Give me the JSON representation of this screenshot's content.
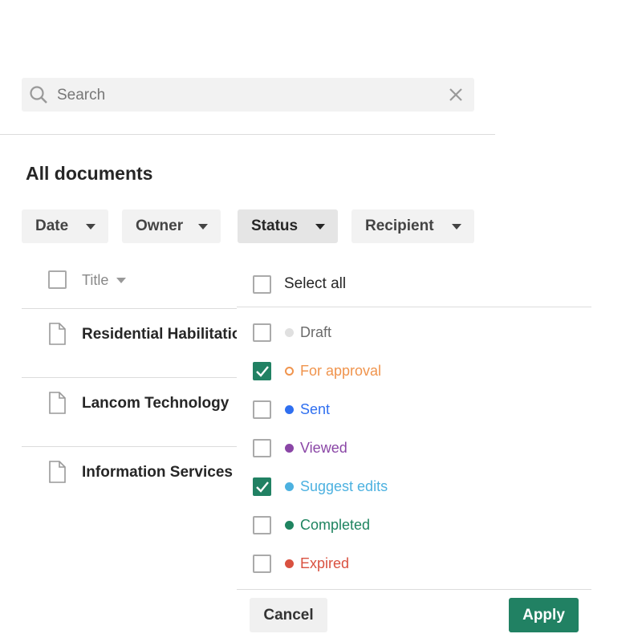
{
  "search": {
    "placeholder": "Search",
    "value": ""
  },
  "heading": "All documents",
  "filters": [
    {
      "label": "Date"
    },
    {
      "label": "Owner"
    },
    {
      "label": "Status"
    },
    {
      "label": "Recipient"
    }
  ],
  "table": {
    "title_header": "Title",
    "rows": [
      {
        "title": "Residential Habilitation"
      },
      {
        "title": "Lancom Technology"
      },
      {
        "title": "Information Services"
      }
    ]
  },
  "status_dropdown": {
    "select_all": "Select all",
    "options": [
      {
        "label": "Draft",
        "checked": false,
        "color": "#6b6b6b",
        "dot": "#e0e0e0"
      },
      {
        "label": "For approval",
        "checked": true,
        "color": "#f0944d",
        "dot": "ring"
      },
      {
        "label": "Sent",
        "checked": false,
        "color": "#2f6ff0",
        "dot": "#2f6ff0"
      },
      {
        "label": "Viewed",
        "checked": false,
        "color": "#8a46a6",
        "dot": "#8a46a6"
      },
      {
        "label": "Suggest edits",
        "checked": true,
        "color": "#4cb1e0",
        "dot": "#4cb1e0"
      },
      {
        "label": "Completed",
        "checked": false,
        "color": "#1f8460",
        "dot": "#1f8460"
      },
      {
        "label": "Expired",
        "checked": false,
        "color": "#d95140",
        "dot": "#d95140"
      }
    ],
    "cancel": "Cancel",
    "apply": "Apply"
  },
  "colors": {
    "accent": "#218163"
  }
}
